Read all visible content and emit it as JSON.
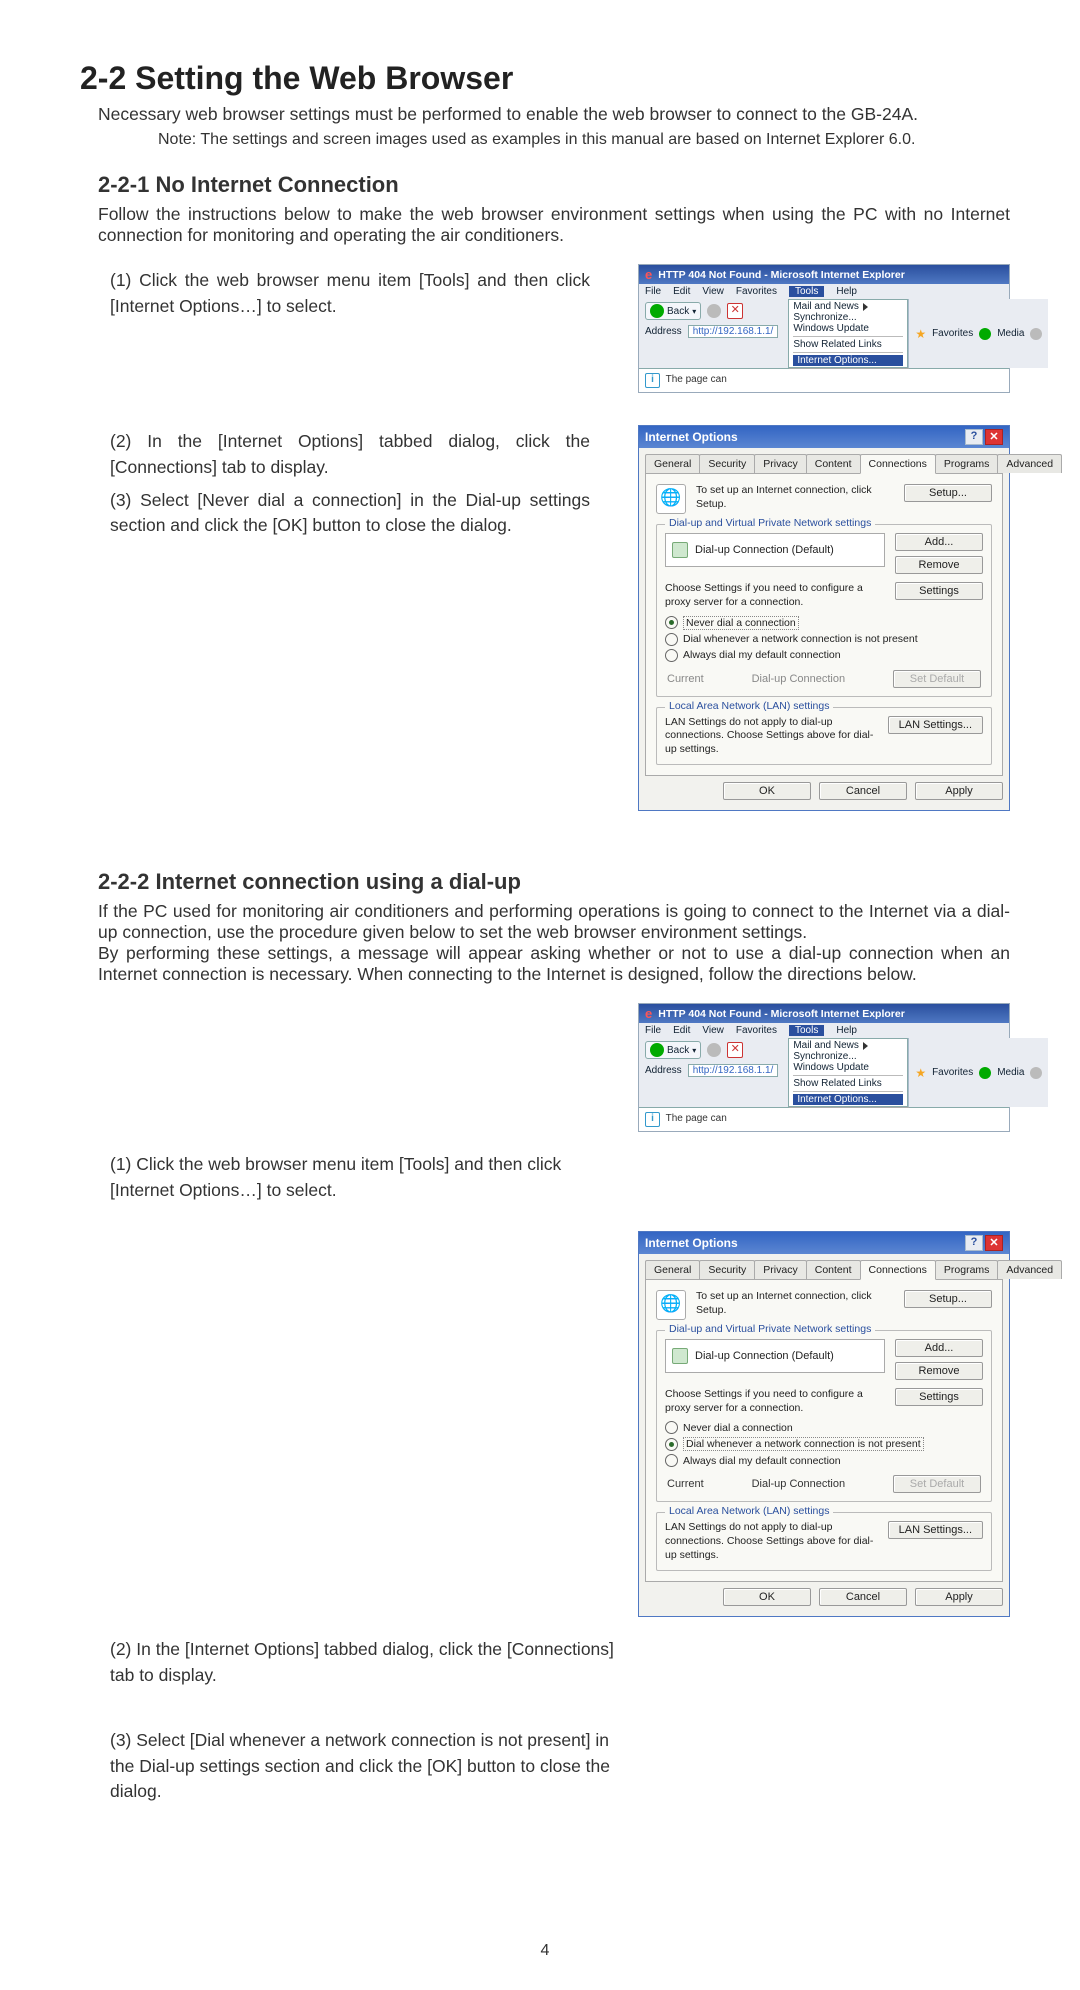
{
  "heading": "2-2 Setting the Web Browser",
  "intro": "Necessary web browser settings must be performed to enable the web browser to connect to the GB-24A.",
  "note": "Note: The settings and screen images used as examples in this manual are based on Internet Explorer 6.0.",
  "sec221": {
    "title": "2-2-1 No Internet Connection",
    "body": "Follow the instructions below to make the web browser environment settings when using the PC with no Internet connection for monitoring and operating the air conditioners.",
    "s1": "(1) Click the web browser menu item [Tools] and then click [Internet Options…] to select.",
    "s2": "(2) In the [Internet Options] tabbed dialog, click the [Connections] tab to display.",
    "s3": "(3) Select [Never dial a connection] in the Dial-up settings section and click the [OK] button to close the dialog."
  },
  "sec222": {
    "title": "2-2-2 Internet connection using a dial-up",
    "body1": "If the PC used for monitoring air conditioners and performing operations is going to connect to the Internet via a dial-up connection, use the procedure given below to set the web browser environment settings.",
    "body2": "By performing these settings, a message will appear asking whether or not to use a dial-up connection when an Internet connection is necessary. When connecting to the Internet is designed, follow the directions below.",
    "s1": "(1) Click the web browser menu item [Tools] and then click [Internet Options…] to select.",
    "s2": "(2) In the [Internet Options] tabbed dialog, click the [Connections] tab to display.",
    "s3": "(3) Select [Dial whenever a network connection is not present] in the Dial-up settings section and click the [OK] button to close the dialog."
  },
  "ie": {
    "title": "HTTP 404 Not Found - Microsoft Internet Explorer",
    "menu": {
      "file": "File",
      "edit": "Edit",
      "view": "View",
      "favorites": "Favorites",
      "tools": "Tools",
      "help": "Help"
    },
    "toolbar": {
      "back": "Back",
      "favorites": "Favorites",
      "media": "Media"
    },
    "dropdown": {
      "mailnews": "Mail and News",
      "sync": "Synchronize...",
      "windowsupdate": "Windows Update",
      "showrelated": "Show Related Links",
      "ioptions": "Internet Options..."
    },
    "addressLabel": "Address",
    "url": "http://192.168.1.1/",
    "pageText": "The page can"
  },
  "io": {
    "title": "Internet Options",
    "tabs": {
      "general": "General",
      "security": "Security",
      "privacy": "Privacy",
      "content": "Content",
      "connections": "Connections",
      "programs": "Programs",
      "advanced": "Advanced"
    },
    "setupText": "To set up an Internet connection, click Setup.",
    "setupBtn": "Setup...",
    "dialupLegend": "Dial-up and Virtual Private Network settings",
    "listEntry": "Dial-up Connection (Default)",
    "addBtn": "Add...",
    "removeBtn": "Remove",
    "settingsBtn": "Settings",
    "chooseText": "Choose Settings if you need to configure a proxy server for a connection.",
    "radio1": "Never dial a connection",
    "radio2": "Dial whenever a network connection is not present",
    "radio3": "Always dial my default connection",
    "currentLabel": "Current",
    "currentVal": "Dial-up Connection",
    "setDefaultBtn": "Set Default",
    "lanLegend": "Local Area Network (LAN) settings",
    "lanText": "LAN Settings do not apply to dial-up connections. Choose Settings above for dial-up settings.",
    "lanBtn": "LAN Settings...",
    "ok": "OK",
    "cancel": "Cancel",
    "apply": "Apply"
  },
  "pageNum": "4"
}
